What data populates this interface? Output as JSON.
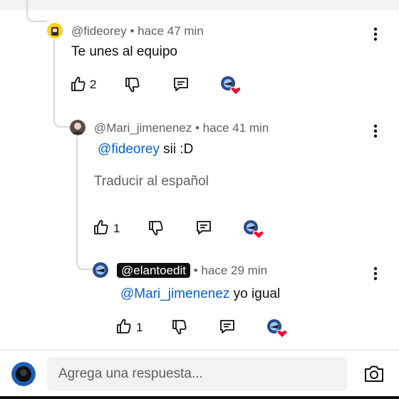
{
  "comments": [
    {
      "author": "@fideorey",
      "time": "• hace 47 min",
      "text": "Te unes al equipo",
      "likes": "2"
    },
    {
      "author": "@Mari_jimenenez",
      "time": "• hace 41 min",
      "mention": "@fideorey",
      "text": " sii :D",
      "translate": "Traducir al español",
      "likes": "1"
    },
    {
      "author": "@elantoedit",
      "time": "• hace 29 min",
      "mention": "@Mari_jimenenez",
      "text": " yo igual",
      "likes": "1"
    }
  ],
  "reply_input": {
    "placeholder": "Agrega una respuesta..."
  },
  "icons": {
    "like": "thumbs-up-icon",
    "dislike": "thumbs-down-icon",
    "reply": "reply-comment-icon",
    "creator_heart": "creator-heart-icon",
    "more": "more-vertical-icon",
    "camera": "camera-icon"
  },
  "colors": {
    "mention": "#065fd4",
    "heart": "#ff0033",
    "meta": "#606060"
  }
}
